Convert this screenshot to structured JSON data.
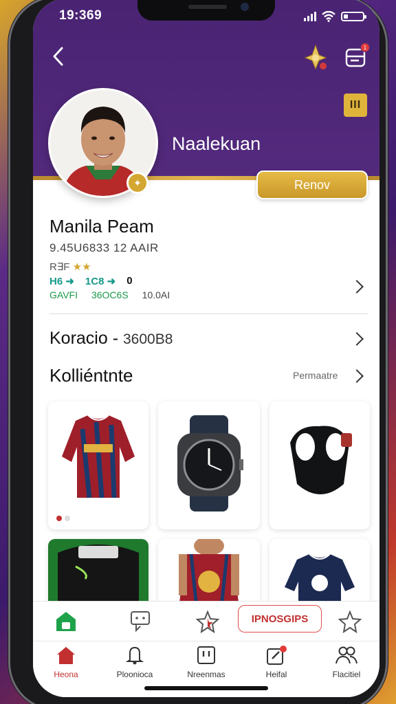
{
  "status": {
    "time": "19:369"
  },
  "header": {
    "profile_name": "Naalekuan",
    "renew_label": "Renov",
    "menu_glyph": "III",
    "notification_count": "1"
  },
  "team": {
    "title": "Manila Peam",
    "subtitle": "9.45U6833 12 AAIR",
    "rating_label": "R∃F",
    "stars": "★★",
    "stats": [
      "H6 ➜",
      "1C8 ➜",
      "0"
    ],
    "stat_labels": [
      "GAVFI",
      "36OC6S",
      "10.0AI"
    ]
  },
  "koracio": {
    "label": "Koracio -",
    "value": "3600B8"
  },
  "kollektion": {
    "title": "Kolliéntnte",
    "more": "Permaatre"
  },
  "products": [
    {
      "name": "jersey-red"
    },
    {
      "name": "smart-watch"
    },
    {
      "name": "shoulder-pad"
    },
    {
      "name": "bag"
    },
    {
      "name": "jersey-red-2"
    },
    {
      "name": "jersey-navy"
    }
  ],
  "actions": {
    "promo_label": "IPNOSGIPS"
  },
  "nav": [
    {
      "label": "Heona",
      "icon": "home-icon"
    },
    {
      "label": "Ploonioca",
      "icon": "bell-icon"
    },
    {
      "label": "Nreenmas",
      "icon": "grid-icon"
    },
    {
      "label": "Heifal",
      "icon": "edit-icon"
    },
    {
      "label": "Flacitiel",
      "icon": "people-icon"
    }
  ],
  "colors": {
    "header_purple": "#532a7d",
    "gold": "#d4a732",
    "accent_red": "#c23030",
    "teal": "#18998a"
  }
}
